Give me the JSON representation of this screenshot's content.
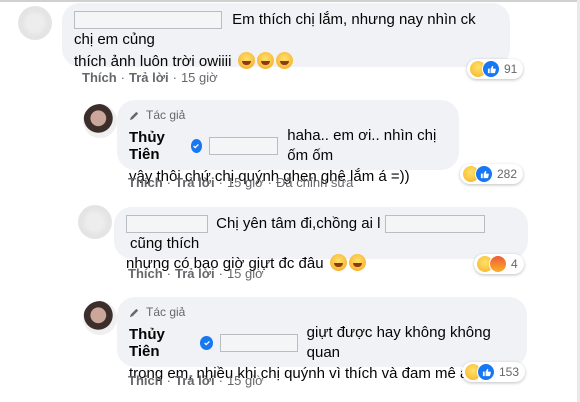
{
  "comments": [
    {
      "text": "Em thích chị lắm, nhưng nay nhìn ck chị em củng thích ảnh luôn trời owiiii",
      "like": "Thích",
      "reply": "Trả lời",
      "time": "15 giờ",
      "reaction_count": "91",
      "reactions": [
        "haha-icon",
        "like-icon"
      ]
    },
    {
      "author_tag": "Tác giả",
      "name": "Thủy Tiên",
      "text": "haha.. em ơi.. nhìn chị ốm ốm vậy thôi chứ chị quýnh ghen ghê lắm á =))",
      "like": "Thích",
      "reply": "Trả lời",
      "time": "15 giờ",
      "edited": "Đã chỉnh sửa",
      "reaction_count": "282",
      "reactions": [
        "haha-icon",
        "like-icon"
      ]
    },
    {
      "text_a": "Chị yên tâm đi,chồng ai l",
      "text_b": "cũng thích",
      "text_c": "nhưng có bao giờ giựt đc đâu",
      "like": "Thích",
      "reply": "Trả lời",
      "time": "15 giờ",
      "reaction_count": "4",
      "reactions": [
        "haha-icon",
        "angry-icon"
      ]
    },
    {
      "author_tag": "Tác giả",
      "name": "Thủy Tiên",
      "text_a": "giựt được hay không không quan",
      "text_b": "trọng em, nhiều khi chị quýnh vì thích và đam mê á =))",
      "like": "Thích",
      "reply": "Trả lời",
      "time": "15 giờ",
      "reaction_count": "153",
      "reactions": [
        "haha-icon",
        "like-icon"
      ]
    }
  ],
  "colors": {
    "bubble": "#f0f2f5",
    "meta": "#65676b",
    "like_blue": "#1877f2"
  }
}
